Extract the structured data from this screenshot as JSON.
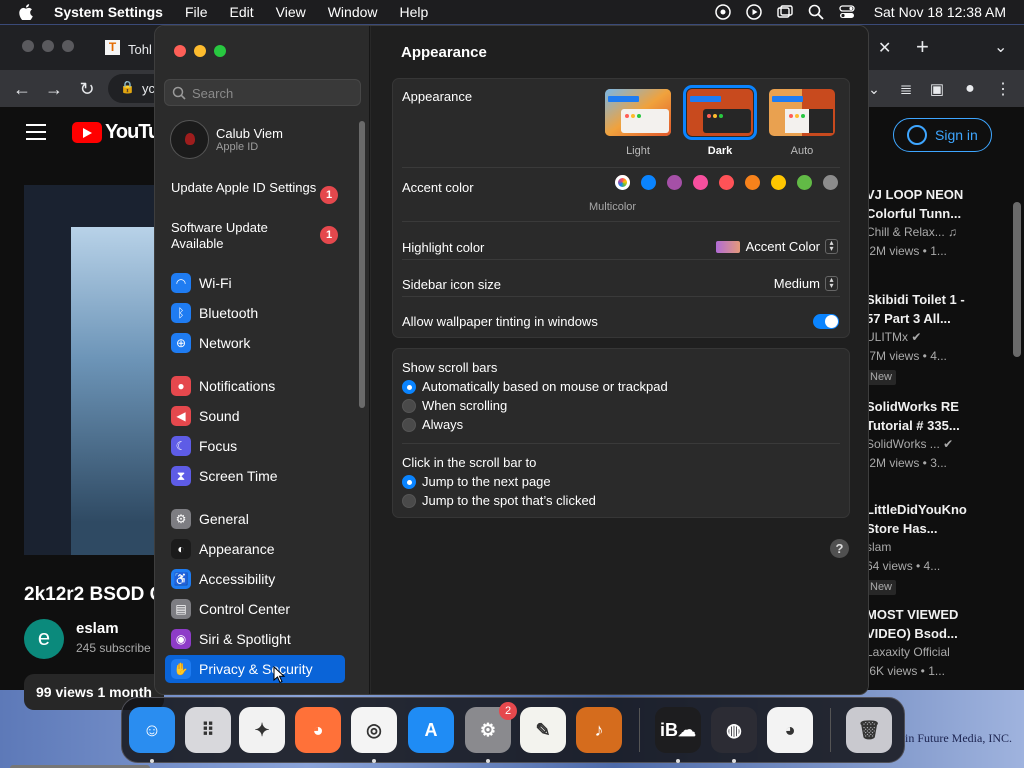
{
  "menubar": {
    "app": "System Settings",
    "items": [
      "File",
      "Edit",
      "View",
      "Window",
      "Help"
    ],
    "clock": "Sat Nov 18  12:38 AM"
  },
  "browser": {
    "tab_title": "Tohl",
    "tab_favicon": "T",
    "url_fragment": "yc",
    "youtube": {
      "logo_text": "YouTub",
      "video_title": "2k12r2 BSOD Co",
      "channel_initial": "e",
      "channel_name": "eslam",
      "channel_subs": "245 subscribe",
      "views": "99 views  1 month",
      "sign_in": "Sign in",
      "recommendations": [
        {
          "t1": "VJ LOOP NEON",
          "t2": "Colorful Tunn...",
          "m1": "Chill & Relax... ♫",
          "m2": ".2M views • 1...",
          "tag": ""
        },
        {
          "t1": "Skibidi Toilet 1 -",
          "t2": "57 Part 3 All...",
          "m1": "ULITMx ✔",
          "m2": ".7M views • 4...",
          "tag": "New"
        },
        {
          "t1": "SolidWorks RE",
          "t2": "Tutorial # 335...",
          "m1": "SolidWorks ... ✔",
          "m2": ".2M views • 3...",
          "tag": ""
        },
        {
          "t1": "LittleDidYouKno",
          "t2": "Store Has...",
          "m1": "slam",
          "m2": "64 views • 4...",
          "tag": "New"
        },
        {
          "t1": "MOST VIEWED",
          "t2": "VIDEO) Bsod...",
          "m1": "Laxaxity Official",
          "m2": ".6K views • 1...",
          "tag": ""
        }
      ]
    }
  },
  "desktop": {
    "corner_text": "in Future Media, INC."
  },
  "settings": {
    "search_placeholder": "Search",
    "user": {
      "name": "Calub Viem",
      "sub": "Apple ID"
    },
    "updates": [
      {
        "label": "Update Apple ID Settings",
        "badge": "1"
      },
      {
        "label": "Software Update Available",
        "badge": "1"
      }
    ],
    "nav_groups": [
      [
        {
          "label": "Wi-Fi",
          "icon": "wifi-icon",
          "color": "#1f7cf2",
          "glyph": "◠"
        },
        {
          "label": "Bluetooth",
          "icon": "bluetooth-icon",
          "color": "#1f7cf2",
          "glyph": "ᛒ"
        },
        {
          "label": "Network",
          "icon": "network-icon",
          "color": "#1f7cf2",
          "glyph": "⊕"
        }
      ],
      [
        {
          "label": "Notifications",
          "icon": "notifications-icon",
          "color": "#e5484d",
          "glyph": "●"
        },
        {
          "label": "Sound",
          "icon": "sound-icon",
          "color": "#e5484d",
          "glyph": "◀"
        },
        {
          "label": "Focus",
          "icon": "focus-icon",
          "color": "#5e5ce6",
          "glyph": "☾"
        },
        {
          "label": "Screen Time",
          "icon": "screen-time-icon",
          "color": "#5e5ce6",
          "glyph": "⧗"
        }
      ],
      [
        {
          "label": "General",
          "icon": "general-icon",
          "color": "#7d7d82",
          "glyph": "⚙"
        },
        {
          "label": "Appearance",
          "icon": "appearance-icon",
          "color": "#1b1b1b",
          "glyph": "◐"
        },
        {
          "label": "Accessibility",
          "icon": "accessibility-icon",
          "color": "#1f7cf2",
          "glyph": "♿"
        },
        {
          "label": "Control Center",
          "icon": "control-center-icon",
          "color": "#7d7d82",
          "glyph": "▤"
        },
        {
          "label": "Siri & Spotlight",
          "icon": "siri-icon",
          "color": "#8e3cc8",
          "glyph": "◉"
        },
        {
          "label": "Privacy & Security",
          "icon": "privacy-hand-icon",
          "color": "#1f7cf2",
          "glyph": "✋"
        }
      ]
    ],
    "selected": "Privacy & Security",
    "page_title": "Appearance",
    "appearance": {
      "label": "Appearance",
      "options": [
        "Light",
        "Dark",
        "Auto"
      ],
      "selected": "Dark"
    },
    "accent": {
      "label": "Accent color",
      "multicolor_label": "Multicolor",
      "colors": [
        "#ffffff",
        "#0a84ff",
        "#a550a7",
        "#f74f9e",
        "#ff5257",
        "#f7821b",
        "#ffc600",
        "#62ba46",
        "#8c8c8c"
      ]
    },
    "highlight": {
      "label": "Highlight color",
      "value": "Accent Color"
    },
    "sidebar_icon_size": {
      "label": "Sidebar icon size",
      "value": "Medium"
    },
    "wallpaper_tinting": {
      "label": "Allow wallpaper tinting in windows",
      "on": true
    },
    "scroll_bars": {
      "label": "Show scroll bars",
      "options": [
        "Automatically based on mouse or trackpad",
        "When scrolling",
        "Always"
      ],
      "selected": 0
    },
    "click_scroll": {
      "label": "Click in the scroll bar to",
      "options": [
        "Jump to the next page",
        "Jump to the spot that’s clicked"
      ],
      "selected": 0
    },
    "help": "?"
  },
  "dock": {
    "apps": [
      {
        "name": "finder",
        "color": "#2a8df0",
        "glyph": "☺"
      },
      {
        "name": "launchpad",
        "color": "#d8d8dc",
        "glyph": "⠿"
      },
      {
        "name": "safari",
        "color": "#f2f2f2",
        "glyph": "✦"
      },
      {
        "name": "firefox",
        "color": "#ff7139",
        "glyph": "◕"
      },
      {
        "name": "chrome",
        "color": "#f4f4f4",
        "glyph": "◎"
      },
      {
        "name": "app-store",
        "color": "#1f8cf5",
        "glyph": "A"
      },
      {
        "name": "system-settings",
        "color": "#8a8a8e",
        "glyph": "⚙",
        "badge": "2"
      },
      {
        "name": "textedit",
        "color": "#f3f3ee",
        "glyph": "✎"
      },
      {
        "name": "garageband",
        "color": "#d56c1d",
        "glyph": "♪"
      },
      {
        "name": "icloud-ib",
        "color": "#1d1d1f",
        "glyph": "iB☁"
      },
      {
        "name": "obs",
        "color": "#2c2c34",
        "glyph": "◍"
      },
      {
        "name": "color-picker",
        "color": "#f3f3f3",
        "glyph": "◕"
      },
      {
        "name": "trash",
        "color": "#c9c9cf",
        "glyph": "🗑"
      }
    ]
  }
}
